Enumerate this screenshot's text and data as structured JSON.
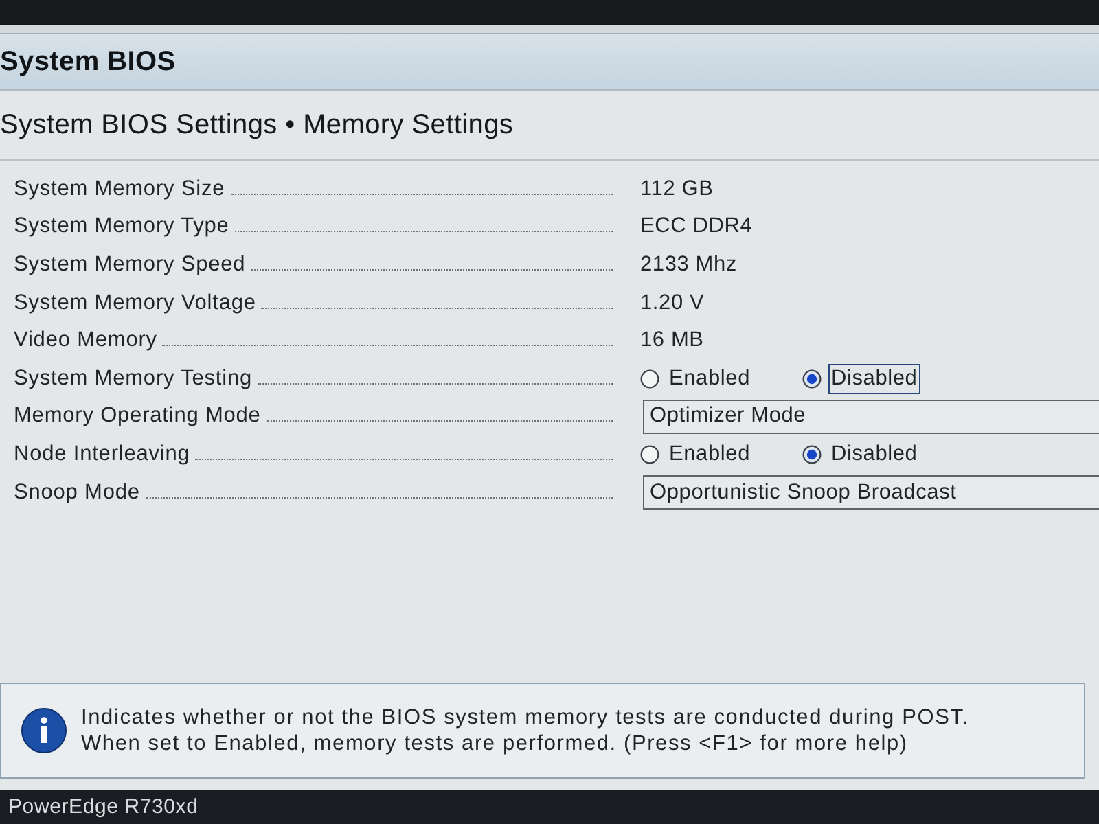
{
  "header": {
    "title": "System BIOS"
  },
  "breadcrumb": "System BIOS Settings • Memory Settings",
  "settings": [
    {
      "kind": "info",
      "label": "System Memory Size",
      "value": "112 GB"
    },
    {
      "kind": "info",
      "label": "System Memory Type",
      "value": "ECC DDR4"
    },
    {
      "kind": "info",
      "label": "System Memory Speed",
      "value": "2133 Mhz"
    },
    {
      "kind": "info",
      "label": "System Memory Voltage",
      "value": "1.20 V"
    },
    {
      "kind": "info",
      "label": "Video Memory",
      "value": "16 MB"
    },
    {
      "kind": "radio",
      "label": "System Memory Testing",
      "options": [
        {
          "label": "Enabled",
          "selected": false,
          "focused": false
        },
        {
          "label": "Disabled",
          "selected": true,
          "focused": true
        }
      ]
    },
    {
      "kind": "dropdown",
      "label": "Memory Operating Mode",
      "value": "Optimizer Mode"
    },
    {
      "kind": "radio",
      "label": "Node Interleaving",
      "options": [
        {
          "label": "Enabled",
          "selected": false,
          "focused": false
        },
        {
          "label": "Disabled",
          "selected": true,
          "focused": false
        }
      ]
    },
    {
      "kind": "dropdown",
      "label": "Snoop Mode",
      "value": "Opportunistic Snoop Broadcast"
    }
  ],
  "help": {
    "text": "Indicates whether or not the BIOS system memory tests are conducted during POST. When set to Enabled, memory tests are performed. (Press <F1> for more help)"
  },
  "footer": {
    "model": "PowerEdge R730xd"
  }
}
